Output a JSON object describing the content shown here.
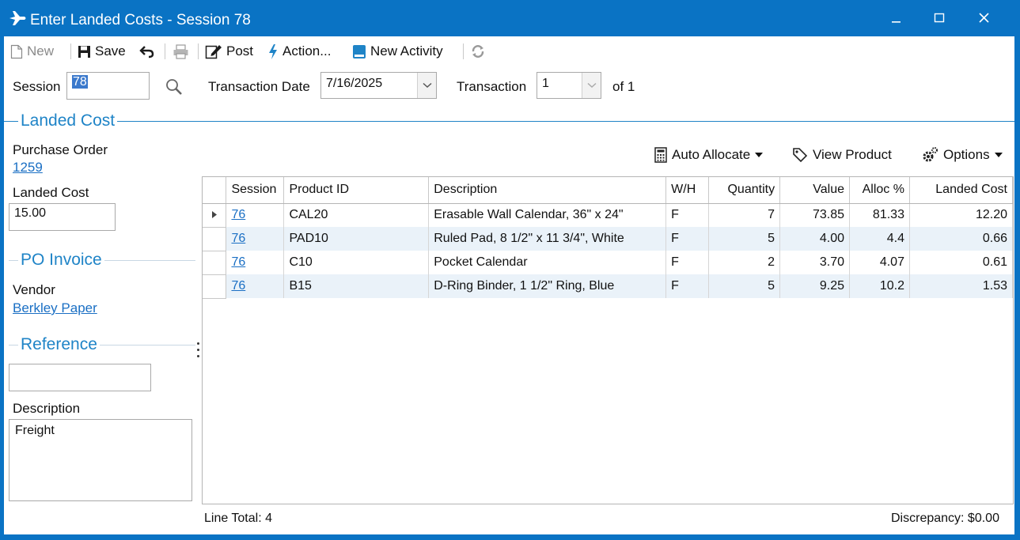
{
  "window": {
    "title": "Enter Landed Costs - Session 78",
    "accent": "#0a73c4"
  },
  "toolbar": {
    "new_label": "New",
    "save_label": "Save",
    "post_label": "Post",
    "action_label": "Action...",
    "new_activity_label": "New Activity"
  },
  "header": {
    "session_label": "Session",
    "session_value": "78",
    "transaction_date_label": "Transaction Date",
    "transaction_date_value": "7/16/2025",
    "transaction_label": "Transaction",
    "transaction_value": "1",
    "of_label": "of 1"
  },
  "landed_cost": {
    "section_title": "Landed Cost",
    "purchase_order_label": "Purchase Order",
    "purchase_order_value": "1259",
    "landed_cost_label": "Landed Cost",
    "landed_cost_value": "15.00"
  },
  "po_invoice": {
    "section_title": "PO Invoice",
    "vendor_label": "Vendor",
    "vendor_value": "Berkley Paper"
  },
  "reference": {
    "section_title": "Reference",
    "reference_value": "",
    "description_label": "Description",
    "description_value": "Freight"
  },
  "grid_toolbar": {
    "auto_allocate_label": "Auto Allocate",
    "view_product_label": "View Product",
    "options_label": "Options"
  },
  "grid": {
    "columns": [
      "Session",
      "Product ID",
      "Description",
      "W/H",
      "Quantity",
      "Value",
      "Alloc %",
      "Landed Cost"
    ],
    "rows": [
      {
        "session": "76",
        "product_id": "CAL20",
        "description": "Erasable Wall Calendar, 36\" x 24\"",
        "wh": "F",
        "quantity": "7",
        "value": "73.85",
        "alloc": "81.33",
        "landed_cost": "12.20"
      },
      {
        "session": "76",
        "product_id": "PAD10",
        "description": "Ruled Pad, 8 1/2\" x 11 3/4\", White",
        "wh": "F",
        "quantity": "5",
        "value": "4.00",
        "alloc": "4.4",
        "landed_cost": "0.66"
      },
      {
        "session": "76",
        "product_id": "C10",
        "description": "Pocket Calendar",
        "wh": "F",
        "quantity": "2",
        "value": "3.70",
        "alloc": "4.07",
        "landed_cost": "0.61"
      },
      {
        "session": "76",
        "product_id": "B15",
        "description": "D-Ring Binder, 1 1/2\" Ring, Blue",
        "wh": "F",
        "quantity": "5",
        "value": "9.25",
        "alloc": "10.2",
        "landed_cost": "1.53"
      }
    ]
  },
  "footer": {
    "line_total": "Line Total: 4",
    "discrepancy": "Discrepancy:  $0.00"
  }
}
